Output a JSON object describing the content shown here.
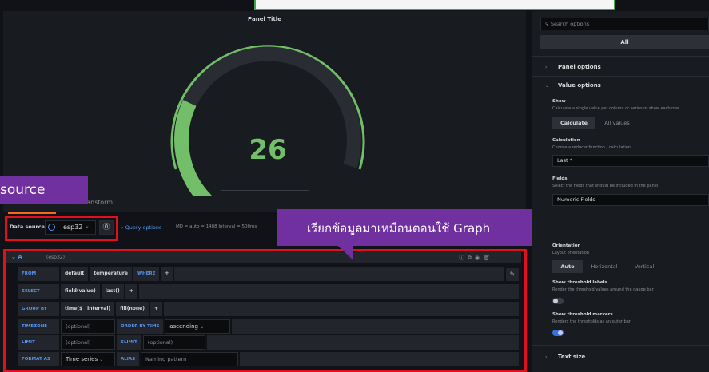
{
  "panel": {
    "title": "Panel Title",
    "gauge_value": "26",
    "gauge_fraction": 0.26,
    "gauge_color": "#73bf69"
  },
  "tabs": {
    "transform_label": "Transform"
  },
  "callouts": {
    "source_text": "source",
    "graph_text": "เรียกข้อมูลมาเหมือนตอนใช้ Graph"
  },
  "datasource": {
    "label": "Data source",
    "selected": "esp32",
    "query_options_label": "Query options",
    "meta": "MD = auto = 1488   Interval = 500ms"
  },
  "query": {
    "ref_id": "A",
    "ds_name": "(esp32)",
    "from": {
      "keyword": "FROM",
      "policy": "default",
      "measurement": "temperature",
      "where": "WHERE",
      "add": "+"
    },
    "select": {
      "keyword": "SELECT",
      "field": "field(value)",
      "agg": "last()",
      "add": "+"
    },
    "group_by": {
      "keyword": "GROUP BY",
      "time": "time($__interval)",
      "fill": "fill(none)",
      "add": "+"
    },
    "timezone": {
      "keyword": "TIMEZONE",
      "placeholder": "(optional)",
      "order_kw": "ORDER BY TIME",
      "order_value": "ascending"
    },
    "limit": {
      "keyword": "LIMIT",
      "placeholder": "(optional)",
      "slimit_kw": "SLIMIT",
      "slimit_placeholder": "(optional)"
    },
    "format": {
      "keyword": "FORMAT AS",
      "value": "Time series",
      "alias_kw": "ALIAS",
      "alias_placeholder": "Naming pattern"
    }
  },
  "options": {
    "search_placeholder": "Search options",
    "all_label": "All",
    "panel_options": "Panel options",
    "value_options": "Value options",
    "show_label": "Show",
    "show_desc": "Calculate a single value per column or series or show each row",
    "calculate_btn": "Calculate",
    "all_values_btn": "All values",
    "calculation_label": "Calculation",
    "calculation_desc": "Choose a reducer function / calculation",
    "calculation_value": "Last *",
    "fields_label": "Fields",
    "fields_desc": "Select the fields that should be included in the panel",
    "fields_value": "Numeric Fields",
    "orientation_label": "Orientation",
    "orientation_desc": "Layout orientation",
    "auto_btn": "Auto",
    "horizontal_btn": "Horizontal",
    "vertical_btn": "Vertical",
    "threshold_labels": "Show threshold labels",
    "threshold_labels_desc": "Render the threshold values around the gauge bar",
    "threshold_markers": "Show threshold markers",
    "threshold_markers_desc": "Renders the thresholds as an outer bar",
    "text_size": "Text size"
  }
}
